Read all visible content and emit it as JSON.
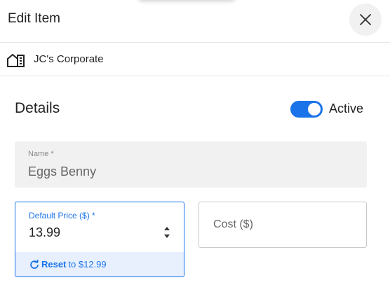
{
  "dialog": {
    "title": "Edit Item",
    "close_icon": "close-icon"
  },
  "location": {
    "icon": "building-icon",
    "name": "JC's Corporate"
  },
  "details": {
    "section_title": "Details",
    "active_label": "Active",
    "active": true
  },
  "fields": {
    "name": {
      "label": "Name *",
      "value": "Eggs Benny"
    },
    "default_price": {
      "label": "Default Price ($) *",
      "value": "13.99",
      "reset_label": "Reset",
      "reset_suffix": "to $12.99"
    },
    "cost": {
      "placeholder": "Cost ($)"
    }
  },
  "colors": {
    "accent": "#1a73e8",
    "reset_bar": "#e8f0fe",
    "disabled_field": "#f1f1f1"
  }
}
